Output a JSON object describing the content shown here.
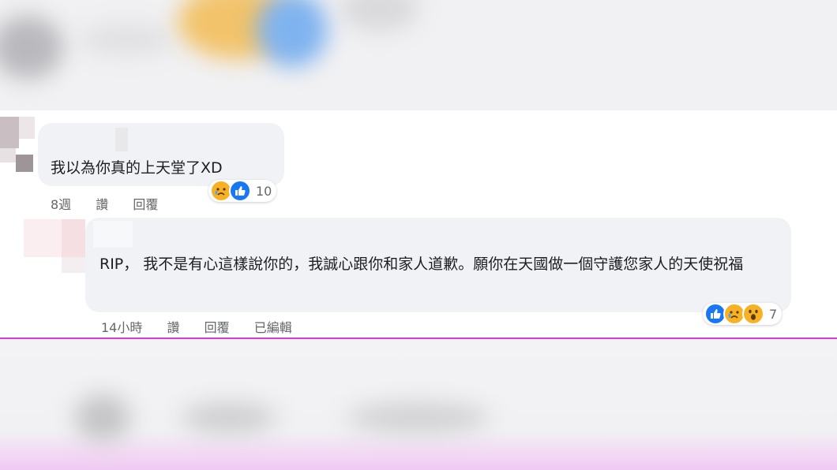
{
  "comments": [
    {
      "text": "我以為你真的上天堂了XD",
      "time": "8週",
      "like_label": "讚",
      "reply_label": "回覆",
      "reactions": [
        "sad-icon",
        "like-icon"
      ],
      "reaction_count": "10"
    },
    {
      "text": "RIP， 我不是有心這樣說你的，我誠心跟你和家人道歉。願你在天國做一個守護您家人的天使祝福",
      "time": "14小時",
      "like_label": "讚",
      "reply_label": "回覆",
      "edited_label": "已編輯",
      "reactions": [
        "like-icon",
        "sad-icon",
        "wow-icon"
      ],
      "reaction_count": "7"
    }
  ],
  "colors": {
    "bubble": "#f0f2f5",
    "meta_text": "#65676b",
    "like_blue": "#1877f2",
    "emoji_yellow": "#f7b125",
    "divider": "#d63cd0"
  }
}
